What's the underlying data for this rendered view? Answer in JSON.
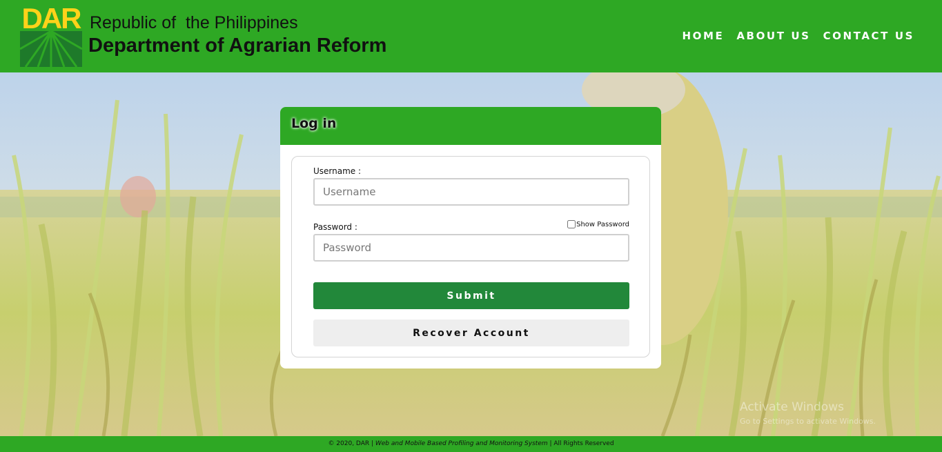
{
  "header": {
    "logo_text": "DAR",
    "line1": "Republic of  the Philippines",
    "line2": "Department of Agrarian Reform",
    "nav": [
      "HOME",
      "ABOUT US",
      "CONTACT US"
    ]
  },
  "login": {
    "title": "Log in",
    "username_label": "Username :",
    "username_placeholder": "Username",
    "password_label": "Password :",
    "password_placeholder": "Password",
    "show_password_label": "Show Password",
    "show_password_checked": false,
    "submit_label": "Submit",
    "recover_label": "Recover Account"
  },
  "watermark": {
    "line1": "Activate Windows",
    "line2": "Go to Settings to activate Windows."
  },
  "footer": {
    "prefix": "© 2020, DAR | ",
    "system_name": "Web and Mobile Based Profiling and Monitoring System",
    "suffix": " | All Rights Reserved"
  },
  "colors": {
    "header_green": "#2ea824",
    "submit_green": "#22883a",
    "logo_yellow": "#ffd21a",
    "logo_green": "#1e7a2a"
  }
}
